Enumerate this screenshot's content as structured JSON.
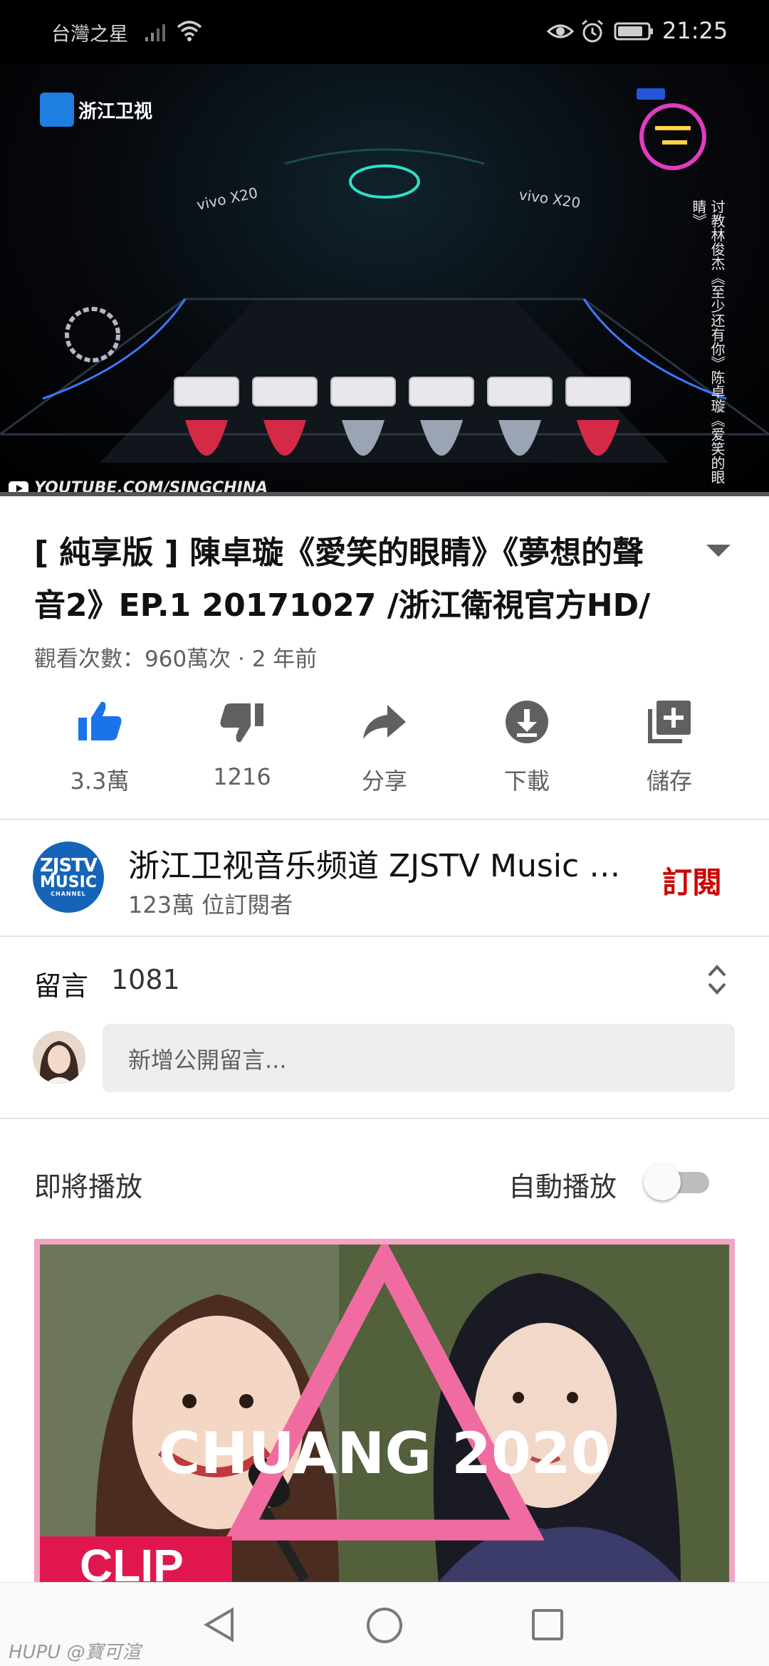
{
  "status_bar": {
    "carrier": "台灣之星",
    "time": "21:25",
    "icons": [
      "signal-icon",
      "wifi-icon",
      "eye-icon",
      "alarm-icon",
      "battery-icon"
    ]
  },
  "video": {
    "network_logo": "浙江卫视",
    "caption": "讨教林俊杰《至少还有你》陈卓璇《爱笑的眼睛》",
    "source": "YOUTUBE.COM/SINGCHINA"
  },
  "title": "[ 純享版 ] 陳卓璇《愛笑的眼睛》《夢想的聲音2》EP.1 20171027 /浙江衛視官方HD/",
  "meta": "觀看次數：960萬次 · 2 年前",
  "actions": [
    {
      "label": "3.3萬",
      "icon": "like-icon"
    },
    {
      "label": "1216",
      "icon": "dislike-icon"
    },
    {
      "label": "分享",
      "icon": "share-icon"
    },
    {
      "label": "下載",
      "icon": "download-icon"
    },
    {
      "label": "儲存",
      "icon": "save-playlist-icon"
    }
  ],
  "channel": {
    "name": "浙江卫视音乐频道 ZJSTV Music Channel",
    "subscribers": "123萬 位訂閱者",
    "subscribe_label": "訂閱",
    "avatar_text": {
      "line1": "ZJSTV",
      "line2": "MUSIC",
      "line3": "CHANNEL"
    }
  },
  "comments": {
    "label": "留言",
    "count": "1081",
    "placeholder": "新增公開留言..."
  },
  "up_next": {
    "label": "即將播放",
    "autoplay_label": "自動播放",
    "autoplay_on": false,
    "thumbnail_badge": "CHUANG 2020",
    "thumbnail_text": "CLIP"
  },
  "watermark": "HUPU @寶可渲",
  "colors": {
    "accent_red": "#cc0000",
    "like_blue": "#1a73e8",
    "thumb_border": "#f2a4c3"
  }
}
